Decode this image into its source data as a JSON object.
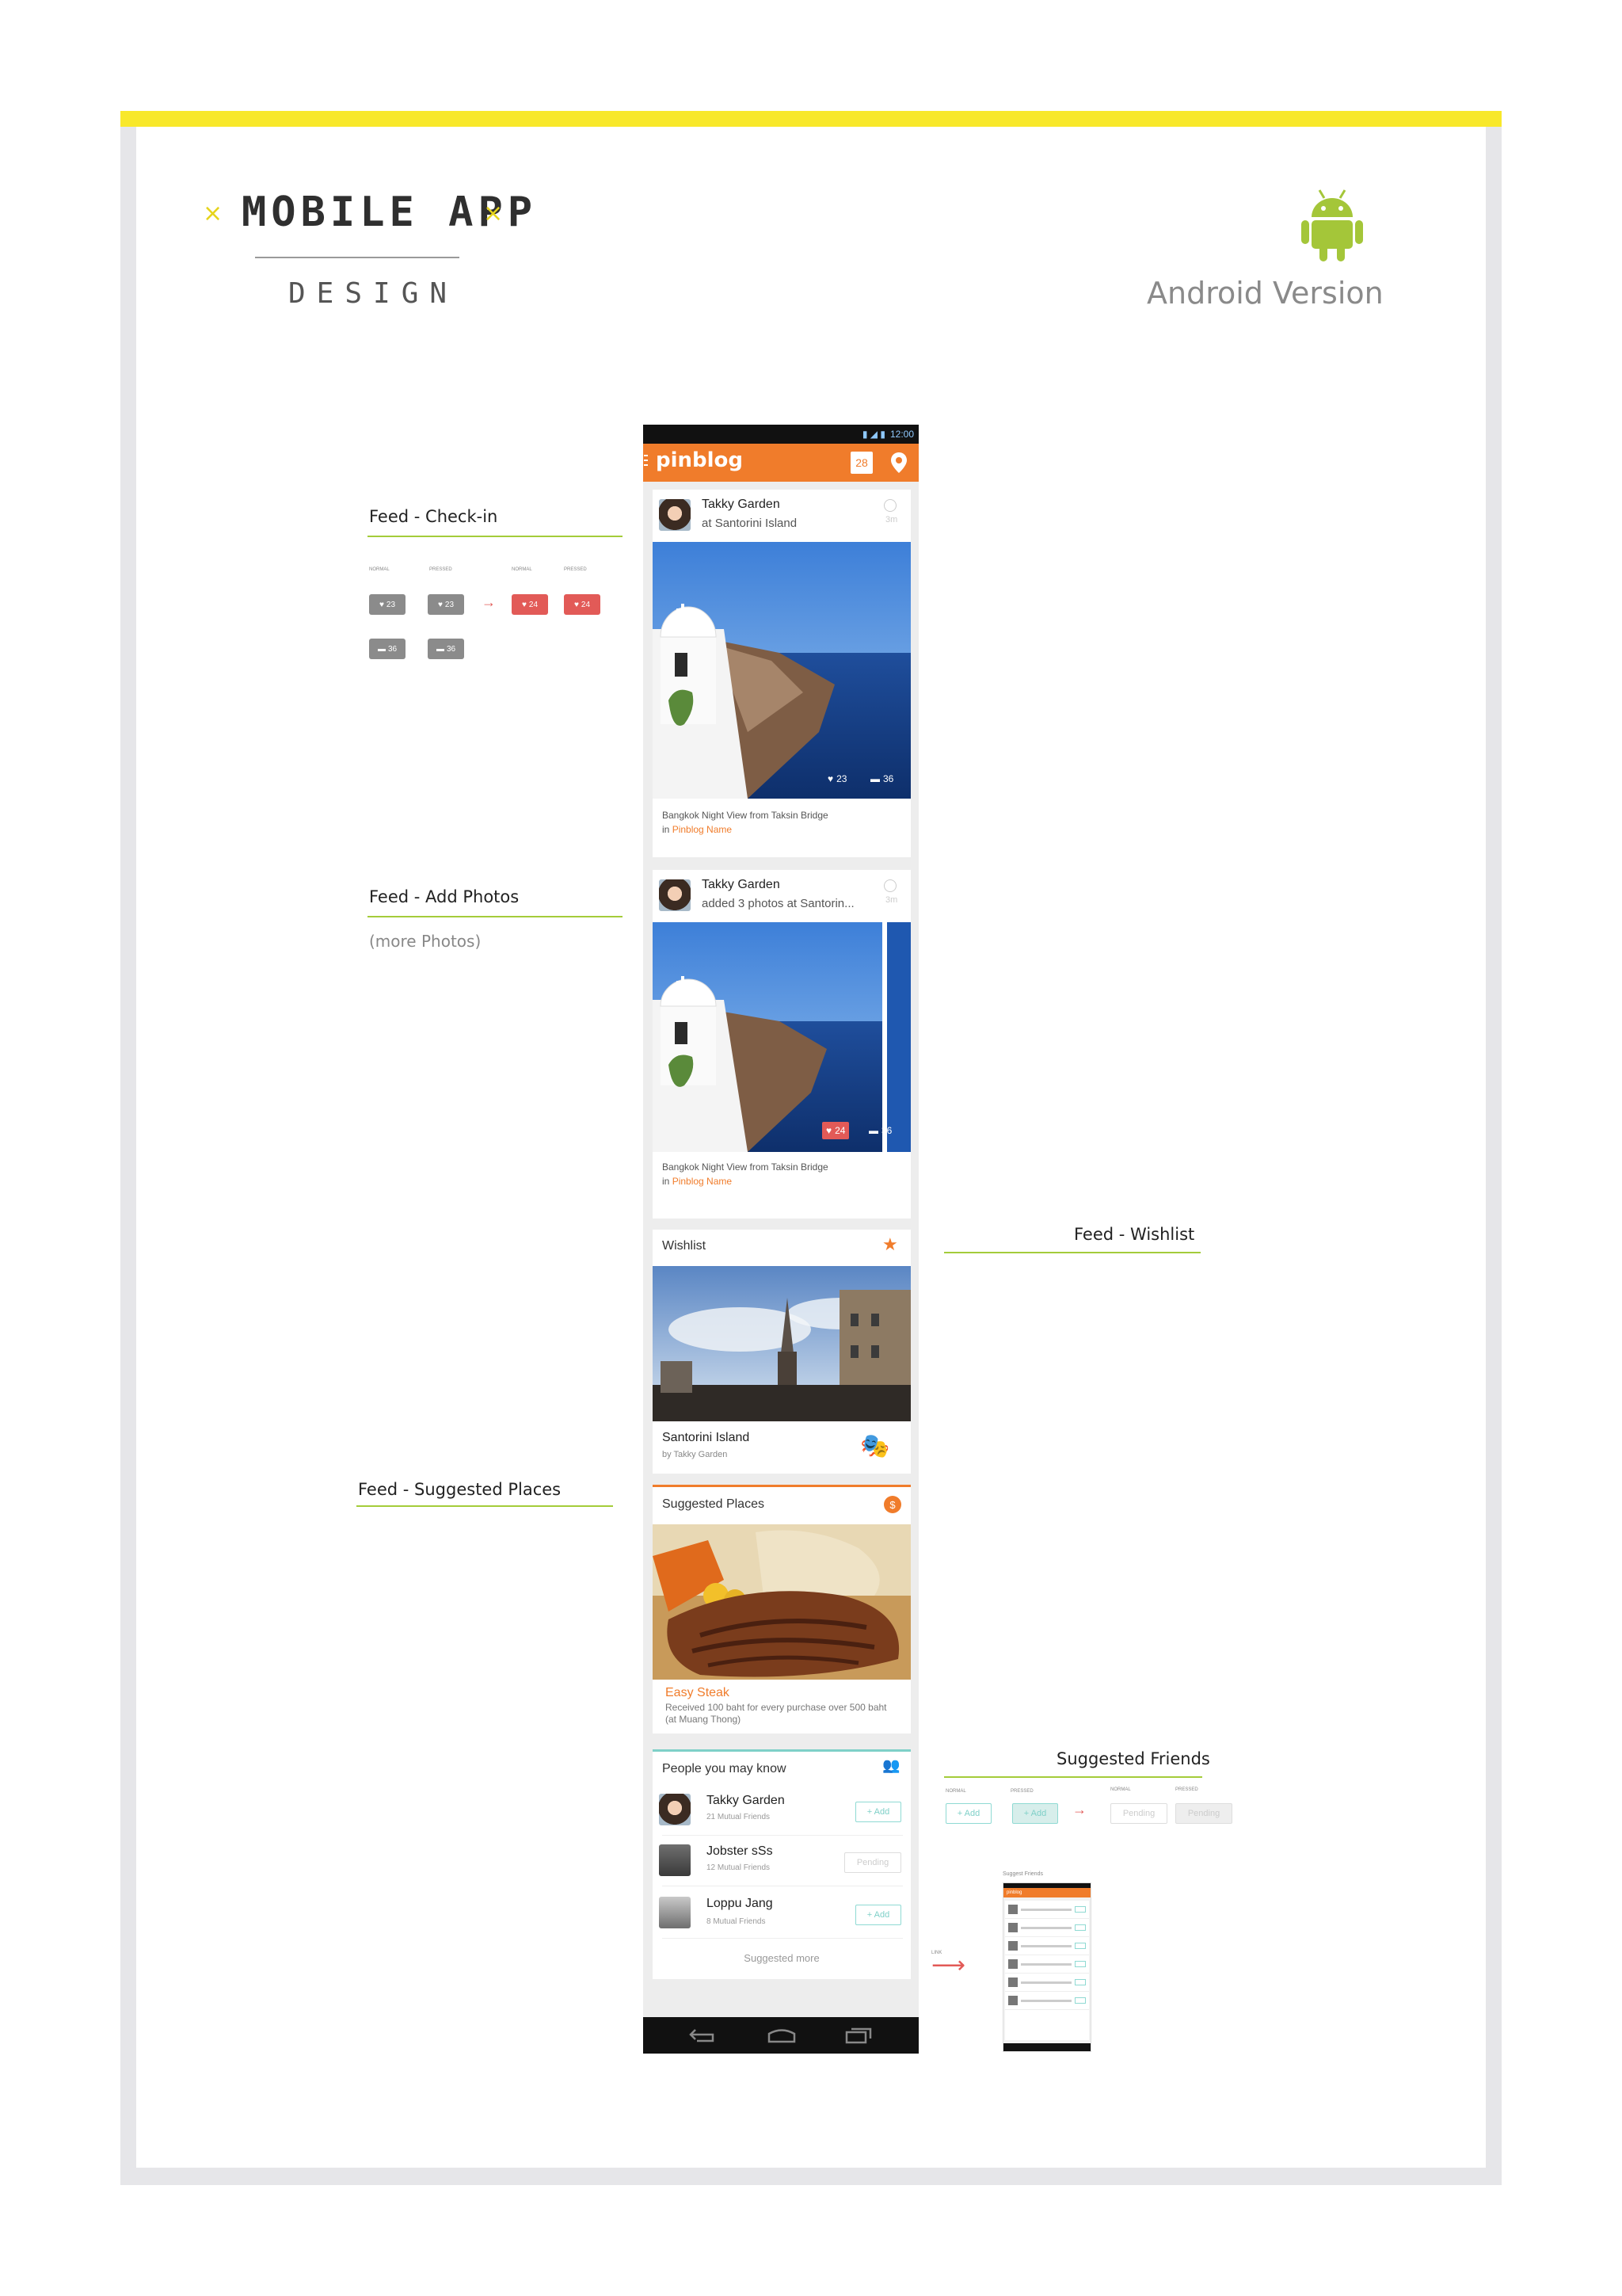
{
  "header": {
    "title": "MOBILE APP",
    "subtitle": "DESIGN",
    "platform": "Android Version"
  },
  "annotations": {
    "checkin": {
      "label": "Feed - Check-in",
      "states": [
        "NORMAL",
        "PRESSED",
        "NORMAL",
        "PRESSED"
      ],
      "like_counts": [
        "23",
        "23",
        "24",
        "24"
      ],
      "comment_counts": [
        "36",
        "36"
      ]
    },
    "add_photos": {
      "label": "Feed - Add Photos",
      "note": "(more Photos)"
    },
    "wishlist": {
      "label": "Feed - Wishlist"
    },
    "suggested_places": {
      "label": "Feed - Suggested Places"
    },
    "suggested_friends": {
      "label": "Suggested Friends",
      "states": [
        "NORMAL",
        "PRESSED",
        "NORMAL",
        "PRESSED"
      ],
      "add_label": "+ Add",
      "pending_label": "Pending",
      "link_note": "LINK"
    }
  },
  "phone": {
    "status_time": "12:00",
    "app_name": "pinblog",
    "badge_count": "28",
    "checkin_card": {
      "user": "Takky Garden",
      "action_prefix": "at",
      "place": "Santorini Island",
      "time": "3m",
      "likes": "23",
      "comments": "36",
      "caption": "Bangkok Night View from Taksin Bridge",
      "in_word": "in",
      "blog_name": "Pinblog Name"
    },
    "photos_card": {
      "user": "Takky Garden",
      "action_prefix": "added 3 photos at",
      "place": "Santorin...",
      "time": "3m",
      "likes": "24",
      "comments": "36",
      "caption": "Bangkok Night View from Taksin Bridge",
      "in_word": "in",
      "blog_name": "Pinblog Name"
    },
    "wishlist_card": {
      "title": "Wishlist",
      "place": "Santorini Island",
      "by": "by Takky Garden"
    },
    "suggested_places_card": {
      "title": "Suggested Places",
      "place": "Easy Steak",
      "description": "Received 100 baht for every purchase over 500 baht (at Muang Thong)"
    },
    "people_card": {
      "title": "People you may know",
      "people": [
        {
          "name": "Takky Garden",
          "mutual": "21 Mutual Friends",
          "action": "+ Add"
        },
        {
          "name": "Jobster sSs",
          "mutual": "12 Mutual Friends",
          "action": "Pending"
        },
        {
          "name": "Loppu Jang",
          "mutual": "8 Mutual Friends",
          "action": "+ Add"
        }
      ],
      "more_label": "Suggested more"
    }
  },
  "mini_preview": {
    "title": "Suggest Friends",
    "app_name": "pinblog"
  },
  "colors": {
    "accent_orange": "#f07c2b",
    "rule_green": "#a4cc3a",
    "top_yellow": "#f8e82a",
    "android_green": "#a4c639",
    "friend_teal": "#7fd0c8",
    "like_red": "#e25a57"
  }
}
